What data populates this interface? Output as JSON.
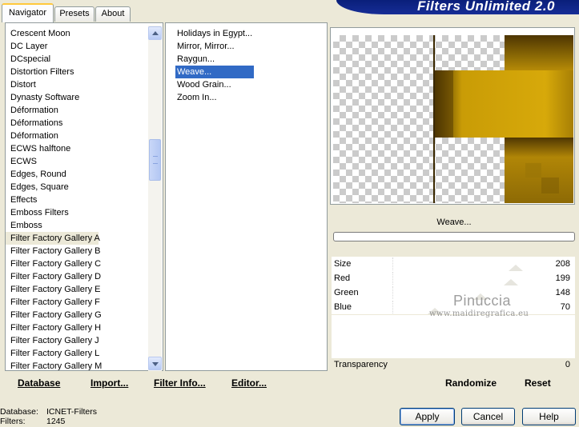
{
  "tabs": [
    "Navigator",
    "Presets",
    "About"
  ],
  "title": "Filters Unlimited 2.0",
  "categories": [
    "Crescent Moon",
    "DC Layer",
    "DCspecial",
    "Distortion Filters",
    "Distort",
    "Dynasty Software",
    "Déformation",
    "Déformations",
    "Déformation",
    "ECWS halftone",
    "ECWS",
    "Edges, Round",
    "Edges, Square",
    "Effects",
    "Emboss Filters",
    "Emboss",
    "Filter Factory Gallery A",
    "Filter Factory Gallery B",
    "Filter Factory Gallery C",
    "Filter Factory Gallery D",
    "Filter Factory Gallery E",
    "Filter Factory Gallery F",
    "Filter Factory Gallery G",
    "Filter Factory Gallery H",
    "Filter Factory Gallery J",
    "Filter Factory Gallery L",
    "Filter Factory Gallery M"
  ],
  "selected_category": "Filter Factory Gallery A",
  "filters": [
    "Holidays in Egypt...",
    "Mirror, Mirror...",
    "Raygun...",
    "Weave...",
    "Wood Grain...",
    "Zoom In..."
  ],
  "selected_filter": "Weave...",
  "current_filter_name": "Weave...",
  "progress": 0,
  "params": [
    {
      "label": "Size",
      "value": "208",
      "fraction": 0.816
    },
    {
      "label": "Red",
      "value": "199",
      "fraction": 0.78
    },
    {
      "label": "Green",
      "value": "148",
      "fraction": 0.58
    },
    {
      "label": "Blue",
      "value": "70",
      "fraction": 0.275
    }
  ],
  "transparency": {
    "label": "Transparency",
    "value": "0"
  },
  "toolbar": {
    "database": "Database",
    "import": "Import...",
    "filter_info": "Filter Info...",
    "editor": "Editor...",
    "randomize": "Randomize",
    "reset": "Reset"
  },
  "status": [
    {
      "label": "Database:",
      "value": "ICNET-Filters"
    },
    {
      "label": "Filters:",
      "value": "1245"
    }
  ],
  "buttons": {
    "apply": "Apply",
    "cancel": "Cancel",
    "help": "Help"
  },
  "watermark": {
    "name": "Pinuccia",
    "site": "www.maidiregrafica.eu"
  },
  "colors": {
    "selection": "#316ac5",
    "banner": "#0a1f7a",
    "weave_gold": "#c79a08",
    "weave_dark": "#4a3302"
  },
  "icons": {
    "scroll_up": "triangle-up",
    "scroll_down": "triangle-down"
  }
}
